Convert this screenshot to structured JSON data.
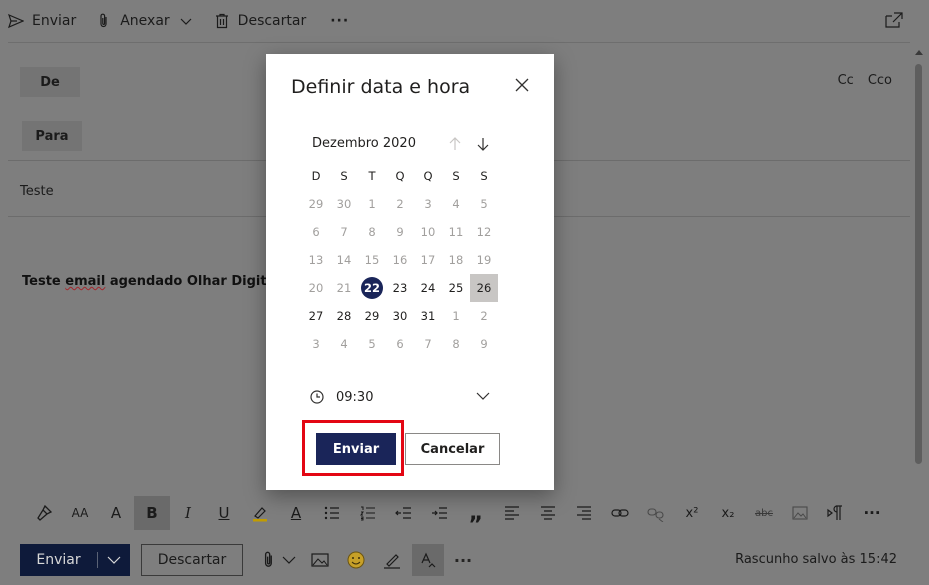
{
  "toolbar": {
    "send_label": "Enviar",
    "attach_label": "Anexar",
    "discard_label": "Descartar",
    "more_label": "···"
  },
  "compose": {
    "from_label": "De",
    "to_label": "Para",
    "cc_label": "Cc",
    "bcc_label": "Cco",
    "subject": "Teste",
    "body_prefix": "Teste ",
    "body_underlined": "email",
    "body_suffix": " agendado Olhar Digital."
  },
  "format_bar": {
    "icons": [
      "format-painter-icon",
      "font-size-icon",
      "grow-font-icon",
      "bold-icon",
      "italic-icon",
      "underline-icon",
      "highlight-icon",
      "font-color-icon",
      "bullets-icon",
      "numbering-icon",
      "decrease-indent-icon",
      "increase-indent-icon",
      "quote-icon",
      "align-left-icon",
      "align-center-icon",
      "align-right-icon",
      "link-icon",
      "unlink-icon",
      "superscript-icon",
      "subscript-icon",
      "strikethrough-icon",
      "picture-icon",
      "ltr-icon",
      "more-icon"
    ],
    "labels": {
      "font_size": "AA",
      "grow": "A",
      "bold": "B",
      "italic": "I",
      "underline": "U",
      "font_color": "A",
      "quote": "„",
      "superscript": "x²",
      "subscript": "x₂",
      "strike": "abc",
      "more": "···"
    }
  },
  "bottom_bar": {
    "send_label": "Enviar",
    "discard_label": "Descartar",
    "more_label": "···",
    "saved_text": "Rascunho salvo às 15:42"
  },
  "dialog": {
    "title": "Definir data e hora",
    "month_label": "Dezembro 2020",
    "weekdays": [
      "D",
      "S",
      "T",
      "Q",
      "Q",
      "S",
      "S"
    ],
    "weeks": [
      [
        "29",
        "30",
        "1",
        "2",
        "3",
        "4",
        "5"
      ],
      [
        "6",
        "7",
        "8",
        "9",
        "10",
        "11",
        "12"
      ],
      [
        "13",
        "14",
        "15",
        "16",
        "17",
        "18",
        "19"
      ],
      [
        "20",
        "21",
        "22",
        "23",
        "24",
        "25",
        "26"
      ],
      [
        "27",
        "28",
        "29",
        "30",
        "31",
        "1",
        "2"
      ],
      [
        "3",
        "4",
        "5",
        "6",
        "7",
        "8",
        "9"
      ]
    ],
    "today": "22",
    "selected": "26",
    "time_value": "09:30",
    "send_button": "Enviar",
    "cancel_button": "Cancelar"
  },
  "colors": {
    "overlay_background": "#7e7e7e",
    "primary": "#1a2559",
    "highlight_box": "#e30613",
    "selected_day": "#c8c6c4"
  }
}
